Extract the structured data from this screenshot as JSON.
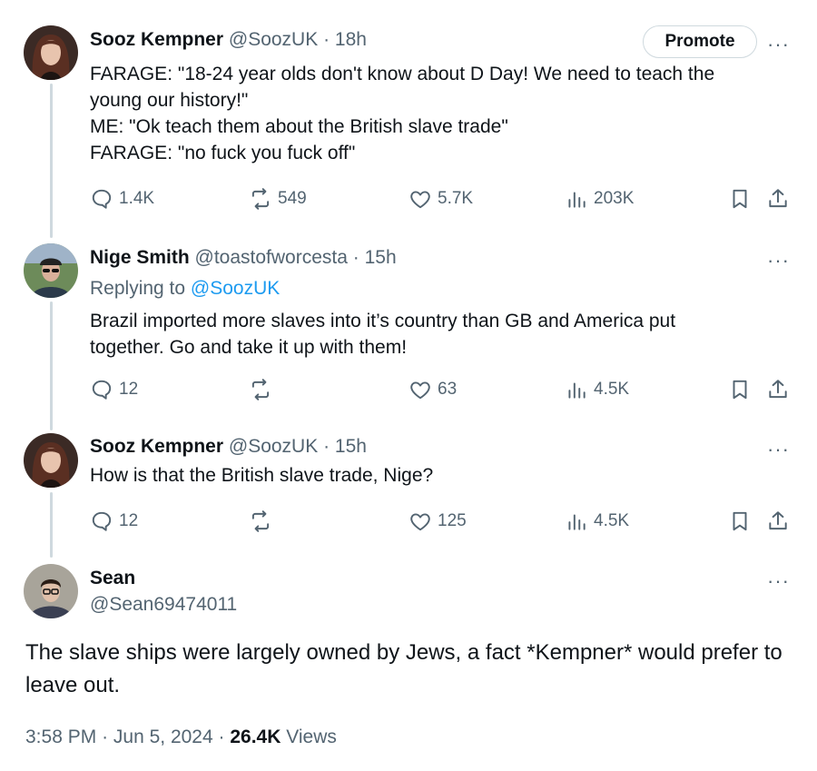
{
  "tweets": [
    {
      "name": "Sooz Kempner",
      "handle": "@SoozUK",
      "time": "18h",
      "promote": "Promote",
      "text": "FARAGE: \"18-24 year olds don't know about D Day! We need to teach the young our history!\"\nME: \"Ok teach them about the British slave trade\"\nFARAGE: \"no fuck you fuck off\"",
      "replies": "1.4K",
      "reposts": "549",
      "likes": "5.7K",
      "views": "203K"
    },
    {
      "name": "Nige Smith",
      "handle": "@toastofworcesta",
      "time": "15h",
      "replying_label": "Replying to",
      "replying_to": "@SoozUK",
      "text": "Brazil imported more slaves into it’s country than GB and America put together. Go and take it up with them!",
      "replies": "12",
      "reposts": "",
      "likes": "63",
      "views": "4.5K"
    },
    {
      "name": "Sooz Kempner",
      "handle": "@SoozUK",
      "time": "15h",
      "text": "How is that the British slave trade, Nige?",
      "replies": "12",
      "reposts": "",
      "likes": "125",
      "views": "4.5K"
    }
  ],
  "main": {
    "name": "Sean",
    "handle": "@Sean69474011",
    "text": "The slave ships were largely owned by Jews, a fact *Kempner* would prefer to leave out.",
    "time": "3:58 PM",
    "date": "Jun 5, 2024",
    "views_count": "26.4K",
    "views_label": "Views"
  },
  "separator": "·",
  "more_glyph": "···",
  "icons": [
    "reply-icon",
    "repost-icon",
    "like-icon",
    "views-icon",
    "bookmark-icon",
    "share-icon",
    "more-icon"
  ]
}
